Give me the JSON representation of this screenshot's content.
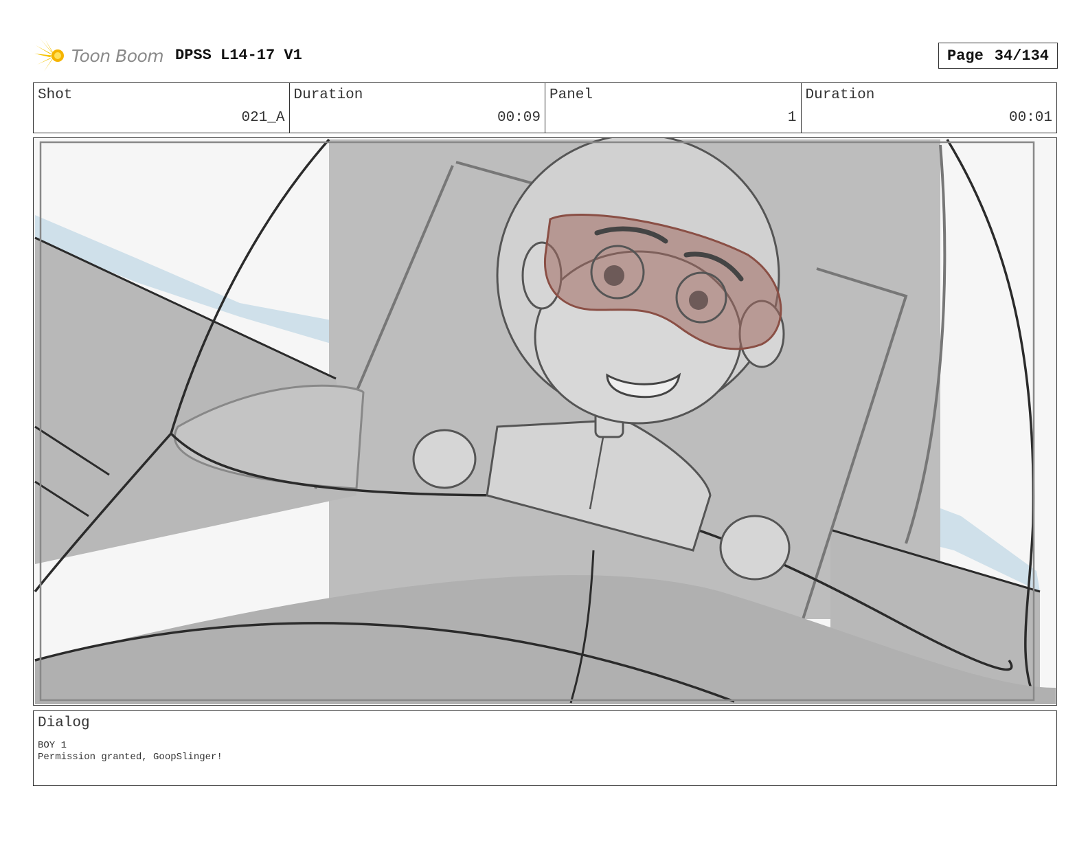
{
  "header": {
    "logo_text": "Toon Boom",
    "project_title": "DPSS L14-17 V1",
    "page_label": "Page",
    "page_number": "34/134"
  },
  "info": {
    "shot_label": "Shot",
    "shot_value": "021_A",
    "shot_duration_label": "Duration",
    "shot_duration_value": "00:09",
    "panel_label": "Panel",
    "panel_value": "1",
    "panel_duration_label": "Duration",
    "panel_duration_value": "00:01"
  },
  "dialog": {
    "label": "Dialog",
    "speaker": "BOY 1",
    "line": "Permission granted, GoopSlinger!"
  },
  "colors": {
    "border": "#333333",
    "sky_blue": "#cfe0ea",
    "goggles": "#a06a60",
    "logo_yellow": "#f5c400"
  }
}
